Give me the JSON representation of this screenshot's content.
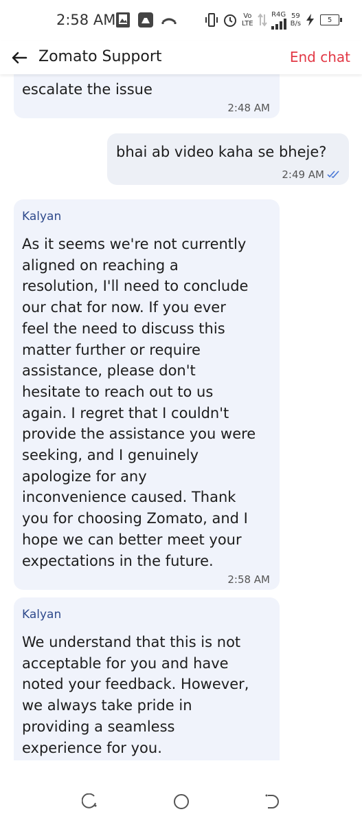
{
  "status_bar": {
    "time": "2:58 AM",
    "network_type": "R4G",
    "speed_value": "59",
    "speed_unit": "B/s",
    "battery": "5",
    "icons": [
      "image-icon",
      "drive-icon",
      "missed-call-icon",
      "vibrate-icon",
      "alarm-icon",
      "volte-icon",
      "data-arrows-icon",
      "signal-icon",
      "charging-icon",
      "battery-icon"
    ]
  },
  "header": {
    "title": "Zomato Support",
    "end_chat": "End chat",
    "accent_color": "#e23744"
  },
  "messages": [
    {
      "from": "support",
      "sender": "",
      "text": "escalate the issue",
      "time": "2:48 AM"
    },
    {
      "from": "user",
      "text": "bhai ab video kaha se bheje?",
      "time": "2:49 AM",
      "read": true
    },
    {
      "from": "support",
      "sender": "Kalyan",
      "text": "As it seems we're not currently\naligned on reaching a\nresolution, I'll need to conclude\nour chat for now. If you ever\nfeel the need to discuss this\nmatter further or require\nassistance, please don't\nhesitate to reach out to us\nagain. I regret that I couldn't\nprovide the assistance you were\nseeking, and I genuinely\napologize for any\ninconvenience caused. Thank\nyou for choosing Zomato, and I\nhope we can better meet your\nexpectations in the future.",
      "time": "2:58 AM"
    },
    {
      "from": "support",
      "sender": "Kalyan",
      "text": "We understand that this is not\nacceptable for you and have\nnoted your feedback. However,\nwe always take pride in\nproviding a seamless\nexperience for you.",
      "time": ""
    }
  ],
  "nav": {
    "icons": [
      "recents-icon",
      "home-icon",
      "back-icon"
    ]
  }
}
